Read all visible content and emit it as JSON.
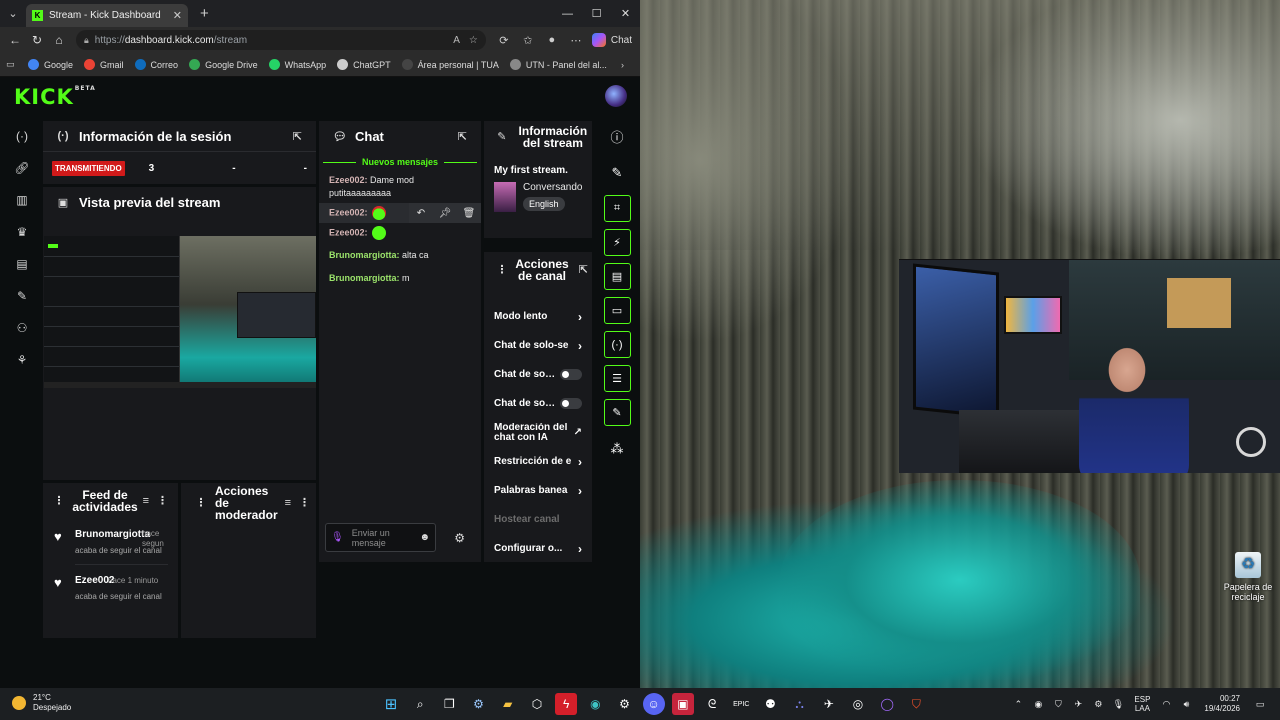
{
  "browser": {
    "tab_title": "Stream - Kick Dashboard",
    "tab_favicon": "K",
    "url_prefix": "https://",
    "url_host": "dashboard.kick.com",
    "url_path": "/stream",
    "copilot_label": "Chat",
    "bookmarks": [
      {
        "label": "Google",
        "color": "#4285f4"
      },
      {
        "label": "Gmail",
        "color": "#ea4335"
      },
      {
        "label": "Correo",
        "color": "#0f6cbd"
      },
      {
        "label": "Google Drive",
        "color": "#34a853"
      },
      {
        "label": "WhatsApp",
        "color": "#25d366"
      },
      {
        "label": "ChatGPT",
        "color": "#cccccc"
      },
      {
        "label": "Área personal | TUA",
        "color": "#444444"
      },
      {
        "label": "UTN - Panel del al...",
        "color": "#888888"
      }
    ]
  },
  "kick": {
    "logo": "KICK",
    "logo_badge": "BETA",
    "accent": "#53fc18",
    "session": {
      "title": "Información de la sesión",
      "live_badge": "TRANSMITIENDO",
      "stat1": "3",
      "stat2": "-",
      "stat3": "-"
    },
    "preview": {
      "title": "Vista previa del stream"
    },
    "feed": {
      "title": "Feed de actividades",
      "items": [
        {
          "user": "Brunomargiotta",
          "time": "hace segun",
          "action": "acaba de seguir el canal"
        },
        {
          "user": "Ezee002",
          "time": "hace 1 minuto",
          "action": "acaba de seguir el canal"
        }
      ]
    },
    "mod_actions": {
      "title": "Acciones de moderador"
    },
    "chat": {
      "title": "Chat",
      "new_messages": "Nuevos mensajes",
      "messages": [
        {
          "user": "Ezee002:",
          "text": "Dame mod putitaaaaaaaaa"
        },
        {
          "user": "Ezee002:",
          "text": ""
        },
        {
          "user": "Ezee002:",
          "text": ""
        },
        {
          "user": "Brunomargiotta:",
          "text": "alta ca"
        },
        {
          "user": "Brunomargiotta:",
          "text": "m"
        }
      ],
      "input_placeholder": "Enviar un mensaje"
    },
    "stream_info": {
      "title": "Información del stream",
      "stream_title": "My first stream.",
      "category": "Conversando",
      "language": "English"
    },
    "channel_actions": {
      "title": "Acciones de canal",
      "items": [
        {
          "label": "Modo lento"
        },
        {
          "label": "Chat de solo-se"
        },
        {
          "label": "Chat de sol..."
        },
        {
          "label": "Chat de sol..."
        },
        {
          "label": "Moderación del chat con IA"
        },
        {
          "label": "Restricción de e"
        },
        {
          "label": "Palabras banea"
        },
        {
          "label": "Hostear canal"
        },
        {
          "label": "Configurar o..."
        }
      ]
    }
  },
  "desktop": {
    "recycle_label": "Papelera de reciclaje"
  },
  "taskbar": {
    "temp": "21°C",
    "weather": "Despejado",
    "lang_line1": "ESP",
    "lang_line2": "LAA",
    "time": "00:27",
    "date": "19/4/2026"
  }
}
